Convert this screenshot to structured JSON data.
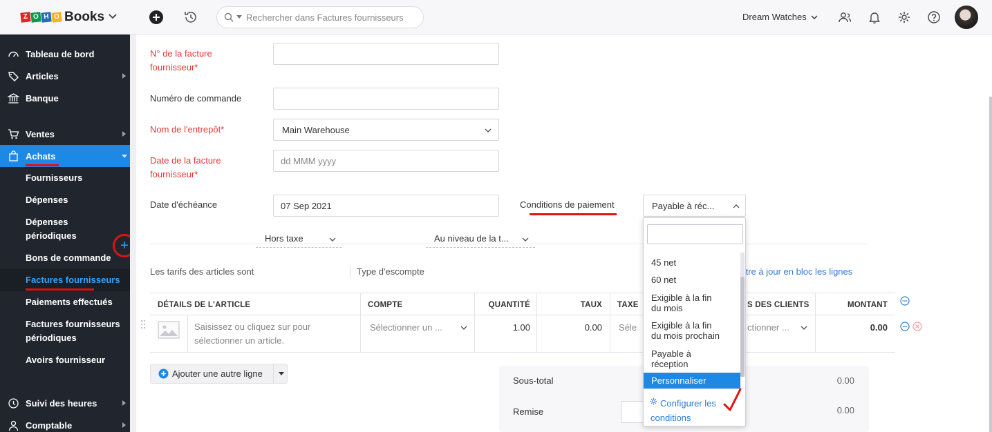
{
  "topbar": {
    "brand_logo_letters": [
      "Z",
      "O",
      "H",
      "O"
    ],
    "brand_logo_colors": [
      "#e42527",
      "#089949",
      "#226db4",
      "#f9b21d"
    ],
    "brand_name": "Books",
    "search_placeholder": "Rechercher dans Factures fournisseurs",
    "org_name": "Dream Watches"
  },
  "sidebar": {
    "items": [
      {
        "label": "Tableau de bord",
        "icon": "dashboard-icon"
      },
      {
        "label": "Articles",
        "icon": "tag-icon"
      },
      {
        "label": "Banque",
        "icon": "bank-icon"
      },
      {
        "label": "Ventes",
        "icon": "cart-icon"
      },
      {
        "label": "Achats",
        "icon": "shopping-bag-icon"
      },
      {
        "label": "Suivi des heures",
        "icon": "clock-icon"
      },
      {
        "label": "Comptable",
        "icon": "person-icon"
      }
    ],
    "achats_sub": [
      "Fournisseurs",
      "Dépenses",
      "Dépenses\npériodiques",
      "Bons de commande",
      "Factures fournisseurs",
      "Paiements effectués",
      "Factures fournisseurs\npériodiques",
      "Avoirs fournisseur"
    ],
    "add_icon": "+"
  },
  "form": {
    "bill_number_label": "N° de la facture\nfournisseur*",
    "order_number_label": "Numéro de commande",
    "warehouse_label": "Nom de l'entrepôt*",
    "warehouse_value": "Main Warehouse",
    "bill_date_label": "Date de la facture\nfournisseur*",
    "bill_date_placeholder": "dd MMM yyyy",
    "due_date_label": "Date d'échéance",
    "due_date_value": "07 Sep 2021",
    "payment_terms_label": "Conditions de paiement",
    "payment_terms_value": "Payable à réc..."
  },
  "items_bar": {
    "tax_label": "Les tarifs des articles sont",
    "tax_value": "Hors taxe",
    "discount_label": "Type d'escompte",
    "discount_value": "Au niveau de la t...",
    "bulk_update_link": "ttre à jour en bloc les lignes"
  },
  "table": {
    "headers": [
      "DÉTAILS DE L'ARTICLE",
      "COMPTE",
      "QUANTITÉ",
      "TAUX",
      "TAXE",
      "S DES CLIENTS",
      "MONTANT"
    ],
    "row": {
      "item_placeholder": "Saisissez ou cliquez sur pour\nsélectionner un article.",
      "account_placeholder": "Sélectionner un ...",
      "quantity": "1.00",
      "rate": "0.00",
      "tax_placeholder": "Séle",
      "customer_placeholder": "ctionner ...",
      "amount": "0.00"
    }
  },
  "add_line_label": "Ajouter une autre ligne",
  "totals": {
    "subtotal_label": "Sous-total",
    "subtotal_value": "0.00",
    "discount_label": "Remise",
    "discount_value": "0.00"
  },
  "payment_dropdown": {
    "search_value": "",
    "options": [
      "45 net",
      "60 net",
      "Exigible à la fin\ndu mois",
      "Exigible à la fin\ndu mois prochain",
      "Payable à\nréception",
      "Personnaliser"
    ],
    "selected": "Personnaliser",
    "configure_link": "Configurer les\nconditions"
  },
  "colors": {
    "accent": "#1e88e5",
    "sidebar_bg": "#21262e",
    "required_label": "#e53935",
    "annotation_red": "#e40f0f",
    "link": "#2f7bd6"
  }
}
